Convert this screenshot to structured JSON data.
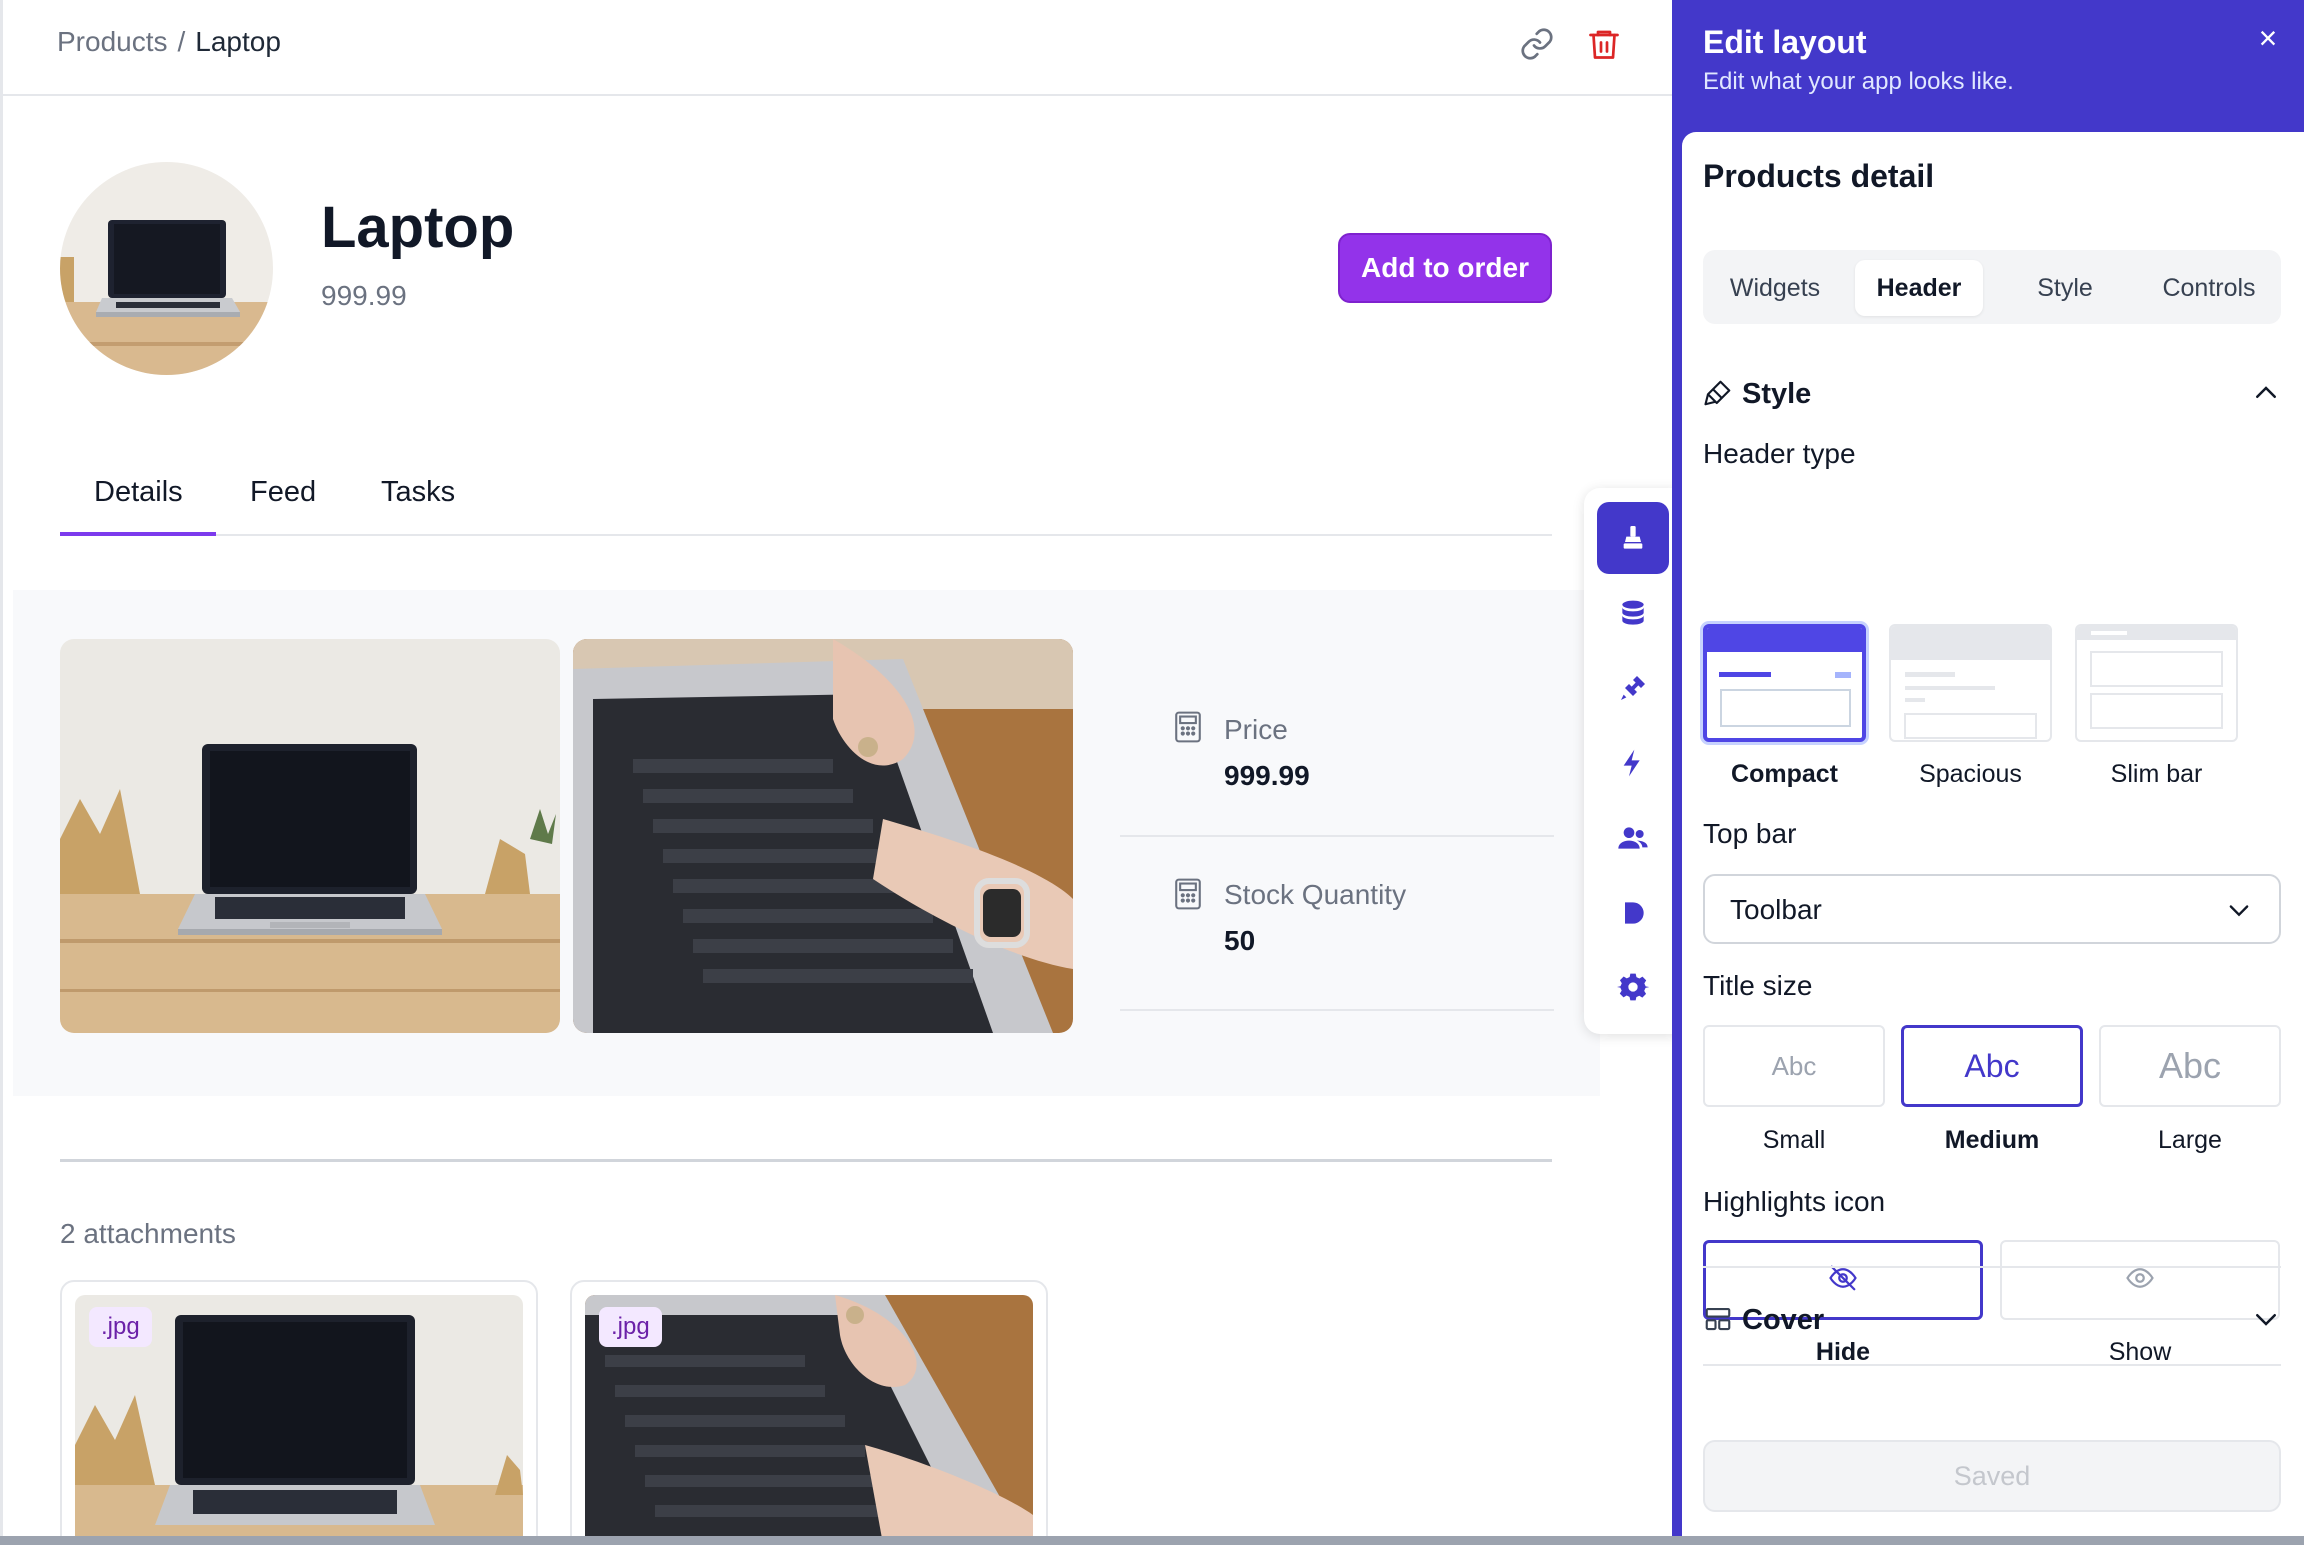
{
  "breadcrumb": {
    "parent": "Products",
    "separator": "/",
    "current": "Laptop"
  },
  "record": {
    "title": "Laptop",
    "subtitle": "999.99",
    "primary_action": "Add to order"
  },
  "tabs": [
    {
      "label": "Details",
      "active": true
    },
    {
      "label": "Feed",
      "active": false
    },
    {
      "label": "Tasks",
      "active": false
    }
  ],
  "fields": [
    {
      "label": "Price",
      "value": "999.99",
      "icon": "calculator-icon"
    },
    {
      "label": "Stock Quantity",
      "value": "50",
      "icon": "calculator-icon"
    }
  ],
  "attachments": {
    "count_label": "2 attachments",
    "items": [
      {
        "ext": ".jpg"
      },
      {
        "ext": ".jpg"
      }
    ]
  },
  "rail": {
    "icons": [
      "brush-icon",
      "database-icon",
      "plug-icon",
      "lightning-icon",
      "users-icon",
      "play-icon",
      "gear-icon"
    ],
    "active": "brush-icon"
  },
  "panel": {
    "title": "Edit layout",
    "subtitle": "Edit what your app looks like.",
    "close_glyph": "×",
    "section_title": "Products detail",
    "segments": [
      {
        "label": "Widgets",
        "active": false
      },
      {
        "label": "Header",
        "active": true
      },
      {
        "label": "Style",
        "active": false
      },
      {
        "label": "Controls",
        "active": false
      }
    ],
    "style_section": {
      "title": "Style",
      "expanded": true,
      "header_type": {
        "label": "Header type",
        "options": [
          {
            "label": "Compact",
            "active": true
          },
          {
            "label": "Spacious",
            "active": false
          },
          {
            "label": "Slim bar",
            "active": false
          }
        ]
      },
      "top_bar": {
        "label": "Top bar",
        "value": "Toolbar"
      },
      "title_size": {
        "label": "Title size",
        "sample": "Abc",
        "options": [
          {
            "label": "Small",
            "active": false
          },
          {
            "label": "Medium",
            "active": true
          },
          {
            "label": "Large",
            "active": false
          }
        ]
      },
      "highlights_icon": {
        "label": "Highlights icon",
        "options": [
          {
            "label": "Hide",
            "active": true,
            "icon": "eye-off-icon"
          },
          {
            "label": "Show",
            "active": false,
            "icon": "eye-icon"
          }
        ]
      }
    },
    "cover_section": {
      "title": "Cover",
      "expanded": false
    },
    "save_label": "Saved"
  },
  "colors": {
    "accent": "#4338ca",
    "primary_button": "#9333ea",
    "tab_underline": "#7c3aed",
    "delete_icon": "#dc2626",
    "badge_bg": "#f3e8ff"
  }
}
